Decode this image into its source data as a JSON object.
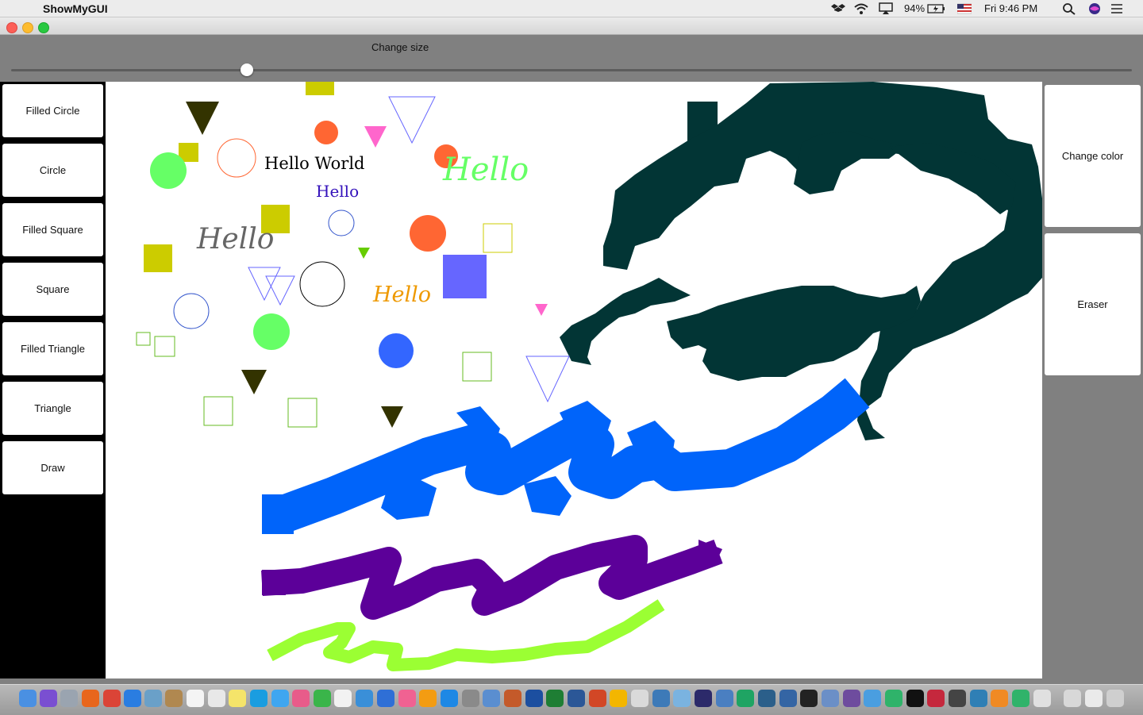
{
  "menubar": {
    "app_name": "ShowMyGUI",
    "battery": "94%",
    "clock": "Fri 9:46 PM"
  },
  "slider": {
    "label": "Change size",
    "value_fraction": 0.21
  },
  "left_tools": [
    {
      "label": "Filled Circle"
    },
    {
      "label": "Circle"
    },
    {
      "label": "Filled Square"
    },
    {
      "label": "Square"
    },
    {
      "label": "Filled Triangle"
    },
    {
      "label": "Triangle"
    },
    {
      "label": "Draw"
    }
  ],
  "right_tools": {
    "change_color": "Change color",
    "eraser": "Eraser"
  },
  "canvas_text": {
    "hello_world": "Hello World",
    "hello_blue": "Hello",
    "hello_green": "Hello",
    "hello_gray": "Hello",
    "hello_orange": "Hello"
  },
  "colors": {
    "dark_teal": "#023535",
    "blue_stroke": "#0064fa",
    "purple_stroke": "#5c0099",
    "lime_stroke": "#9bff33",
    "olive": "#cccc00",
    "orange": "#ff6633",
    "green": "#66ff66",
    "pink": "#ff66cc",
    "periwinkle": "#6666ff"
  }
}
